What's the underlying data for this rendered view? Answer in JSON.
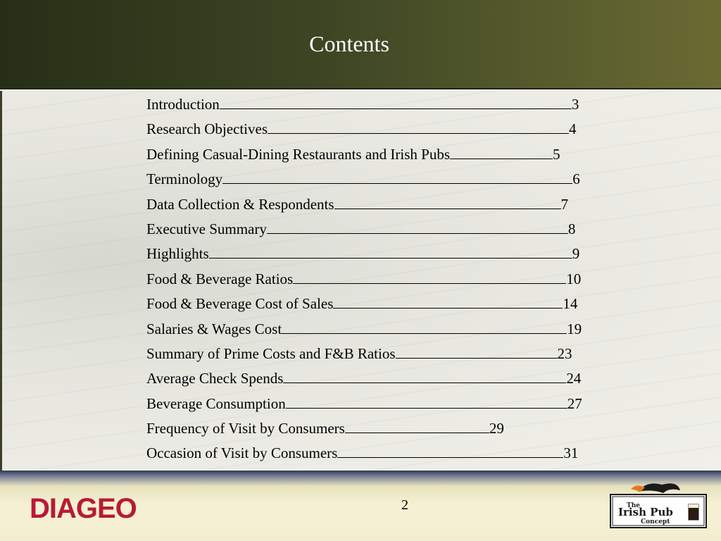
{
  "slide": {
    "title": "Contents",
    "page_number": "2"
  },
  "toc": [
    {
      "label": "Introduction",
      "page": "3",
      "leader": 500
    },
    {
      "label": "Research Objectives",
      "page": "4",
      "leader": 428
    },
    {
      "label": "Defining Casual-Dining Restaurants and Irish Pubs",
      "page": "5",
      "leader": 146
    },
    {
      "label": "Terminology",
      "page": "6",
      "leader": 497
    },
    {
      "label": "Data Collection & Respondents",
      "page": "7",
      "leader": 322
    },
    {
      "label": "Executive Summary",
      "page": "8",
      "leader": 428
    },
    {
      "label": "Highlights",
      "page": "9",
      "leader": 516
    },
    {
      "label": "Food & Beverage Ratios",
      "page": "10",
      "leader": 388
    },
    {
      "label": "Food & Beverage Cost of Sales",
      "page": "14",
      "leader": 326
    },
    {
      "label": "Salaries & Wages Cost",
      "page": "19",
      "leader": 405
    },
    {
      "label": "Summary of Prime Costs and F&B Ratios",
      "page": "23",
      "leader": 230
    },
    {
      "label": "Average Check Spends",
      "page": "24",
      "leader": 402
    },
    {
      "label": "Beverage Consumption",
      "page": "27",
      "leader": 400
    },
    {
      "label": "Frequency of Visit by Consumers",
      "page": "29",
      "leader": 205
    },
    {
      "label": "Occasion of Visit by Consumers",
      "page": "31",
      "leader": 321
    }
  ],
  "brand": {
    "logo_text": "DIAGEO",
    "logo_color": "#b81a36",
    "badge_line1": "The",
    "badge_line2": "Irish Pub",
    "badge_line3": "Concept"
  }
}
